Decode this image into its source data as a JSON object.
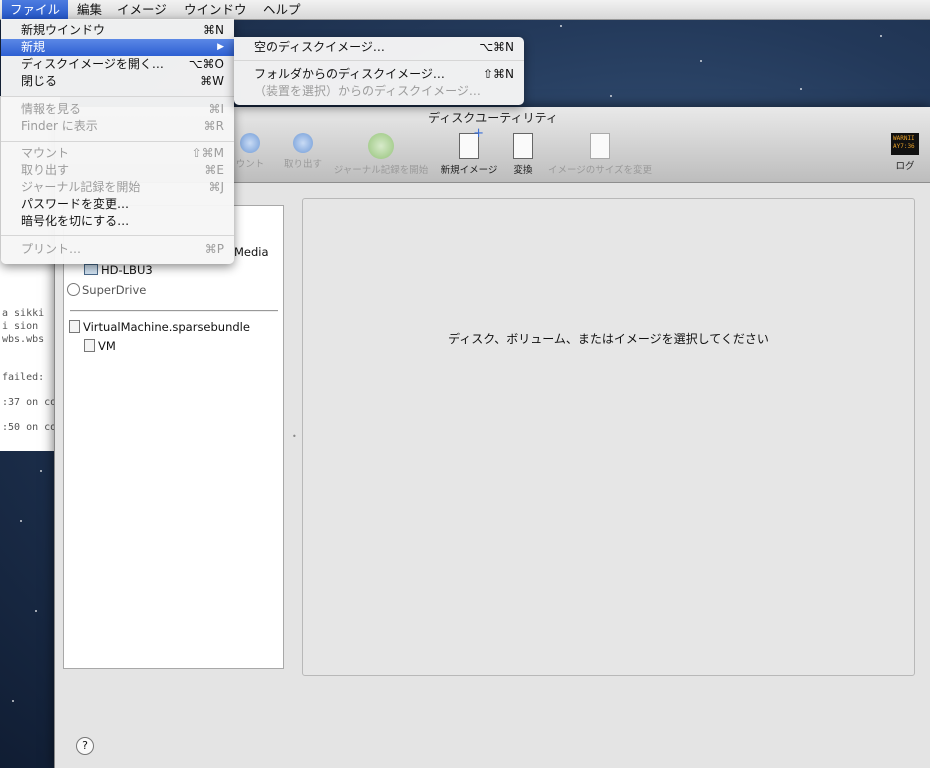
{
  "menubar": {
    "items": [
      "ファイル",
      "編集",
      "イメージ",
      "ウインドウ",
      "ヘルプ"
    ]
  },
  "file_menu": {
    "new_window": {
      "label": "新規ウインドウ",
      "shortcut": "⌘N"
    },
    "new": {
      "label": "新規",
      "arrow": "▶"
    },
    "open_disk_image": {
      "label": "ディスクイメージを開く…",
      "shortcut": "⌥⌘O"
    },
    "close": {
      "label": "閉じる",
      "shortcut": "⌘W"
    },
    "get_info": {
      "label": "情報を見る",
      "shortcut": "⌘I"
    },
    "show_in_finder": {
      "label": "Finder に表示",
      "shortcut": "⌘R"
    },
    "mount": {
      "label": "マウント",
      "shortcut": "⇧⌘M"
    },
    "eject": {
      "label": "取り出す",
      "shortcut": "⌘E"
    },
    "enable_journaling": {
      "label": "ジャーナル記録を開始",
      "shortcut": "⌘J"
    },
    "change_password": {
      "label": "パスワードを変更…"
    },
    "turn_off_encryption": {
      "label": "暗号化を切にする…"
    },
    "print": {
      "label": "プリント…",
      "shortcut": "⌘P"
    }
  },
  "new_submenu": {
    "blank_image": {
      "label": "空のディスクイメージ…",
      "shortcut": "⌥⌘N"
    },
    "from_folder": {
      "label": "フォルダからのディスクイメージ…",
      "shortcut": "⇧⌘N"
    },
    "from_device": {
      "label": "（装置を選択）からのディスクイメージ…"
    }
  },
  "window": {
    "title": "ディスクユーティリティ",
    "toolbar": [
      {
        "label": "ウント"
      },
      {
        "label": "取り出す"
      },
      {
        "label": "ジャーナル記録を開始"
      },
      {
        "label": "新規イメージ"
      },
      {
        "label": "変換"
      },
      {
        "label": "イメージのサイズを変更"
      },
      {
        "label": "ログ"
      }
    ],
    "log_icon_text": [
      "WARNII",
      "AY7:36"
    ],
    "sidebar": {
      "media_partial": "Media",
      "hd_lbu3": "HD-LBU3",
      "superdrive": "SuperDrive",
      "sparsebundle": "VirtualMachine.sparsebundle",
      "vm": "VM"
    },
    "detail_hint": "ディスク、ボリューム、またはイメージを選択してください",
    "help": "?"
  },
  "terminal_lines": [
    "a  sikki",
    "i  sion",
    "  wbs.wbs",
    " failed:",
    ":37 on co",
    ":50 on co"
  ],
  "colors": {
    "highlight": "#2d5fd2",
    "desktop": "#23395a"
  }
}
